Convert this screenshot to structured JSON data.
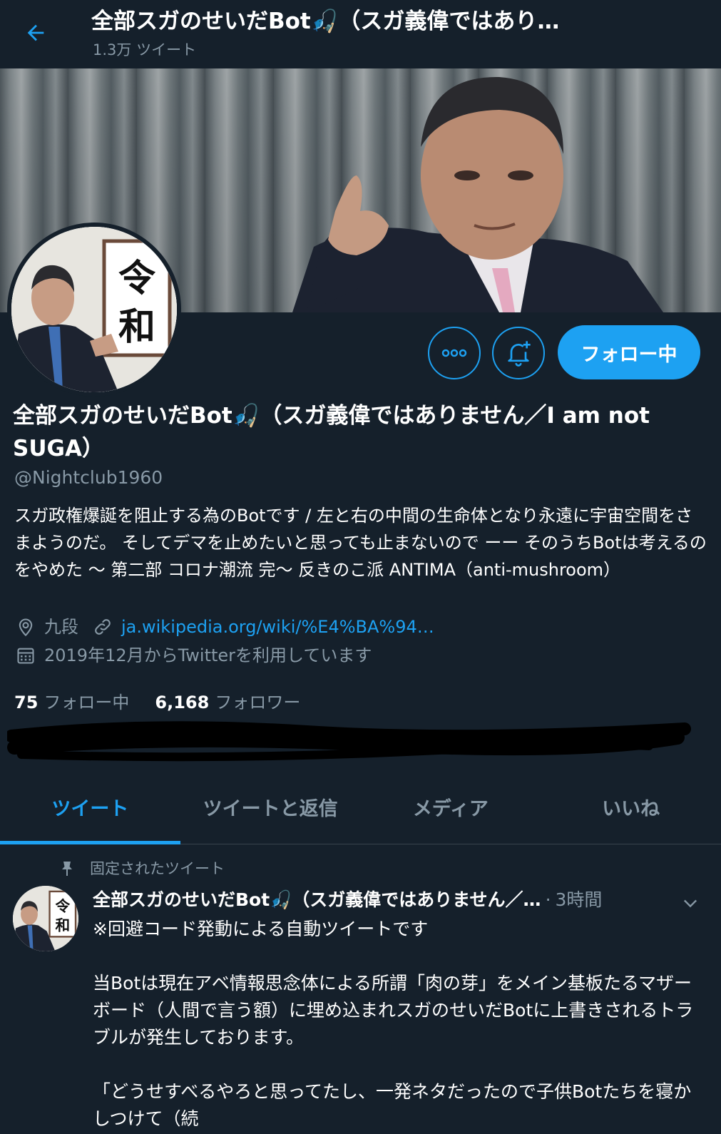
{
  "header": {
    "title": "全部スガのせいだBot🎣（スガ義偉ではあり…",
    "tweet_count": "1.3万 ツイート"
  },
  "profile": {
    "name": "全部スガのせいだBot🎣（スガ義偉ではありません／I am not SUGA）",
    "handle": "@Nightclub1960",
    "bio": "スガ政権爆誕を阻止する為のBotです / 左と右の中間の生命体となり永遠に宇宙空間をさまようのだ。 そしてデマを止めたいと思っても止まないので ーー そのうちBotは考えるのをやめた 〜 第二部 コロナ潮流 完〜 反きのこ派 ANTIMA（anti-mushroom）",
    "location": "九段",
    "url": "ja.wikipedia.org/wiki/%E4%BA%94…",
    "joined": "2019年12月からTwitterを利用しています",
    "following_count": "75",
    "following_label": "フォロー中",
    "followers_count": "6,168",
    "followers_label": "フォロワー",
    "follow_button": "フォロー中",
    "avatar_text": "令和"
  },
  "tabs": [
    {
      "label": "ツイート",
      "active": true
    },
    {
      "label": "ツイートと返信",
      "active": false
    },
    {
      "label": "メディア",
      "active": false
    },
    {
      "label": "いいね",
      "active": false
    }
  ],
  "tweet": {
    "pinned_label": "固定されたツイート",
    "author": "全部スガのせいだBot🎣（スガ義偉ではありません／…",
    "separator": "·",
    "time": "3時間",
    "body": "※回避コード発動による自動ツイートです\n\n当Botは現在アベ情報思念体による所謂「肉の芽」をメイン基板たるマザーボード（人間で言う額）に埋め込まれスガのせいだBotに上書きされるトラブルが発生しております。\n\n「どうせすべるやろと思ってたし、一発ネタだったので子供Botたちを寝かしつけて（続"
  },
  "colors": {
    "background": "#15202b",
    "accent": "#1da1f2",
    "secondary_text": "#8899a6",
    "divider": "#38444d"
  },
  "icons": {
    "back": "arrow-left-icon",
    "more": "more-dots-icon",
    "bell": "notification-bell-plus-icon",
    "location": "location-pin-icon",
    "link": "link-icon",
    "calendar": "calendar-icon",
    "pin": "pin-icon",
    "caret": "chevron-down-icon"
  }
}
